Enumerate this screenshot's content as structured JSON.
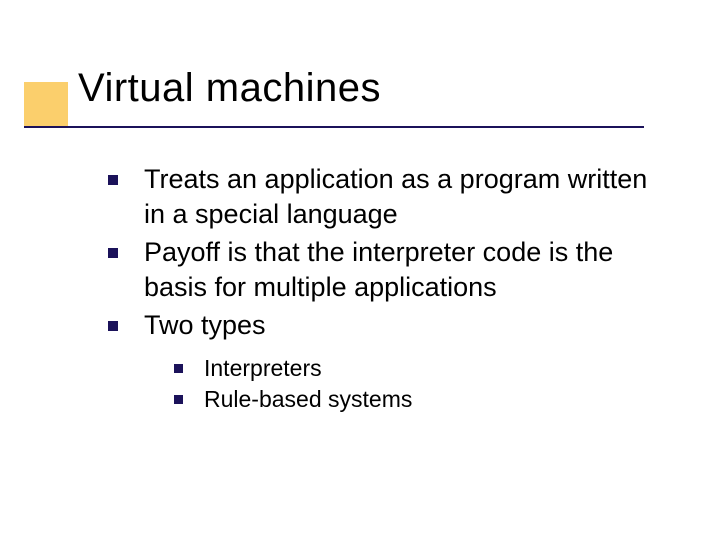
{
  "title": "Virtual machines",
  "bullets": [
    {
      "text": "Treats an application as a program written in a special language"
    },
    {
      "text": "Payoff is that the interpreter code is the basis for multiple applications"
    },
    {
      "text": "Two types",
      "children": [
        {
          "text": "Interpreters"
        },
        {
          "text": "Rule-based systems"
        }
      ]
    }
  ]
}
